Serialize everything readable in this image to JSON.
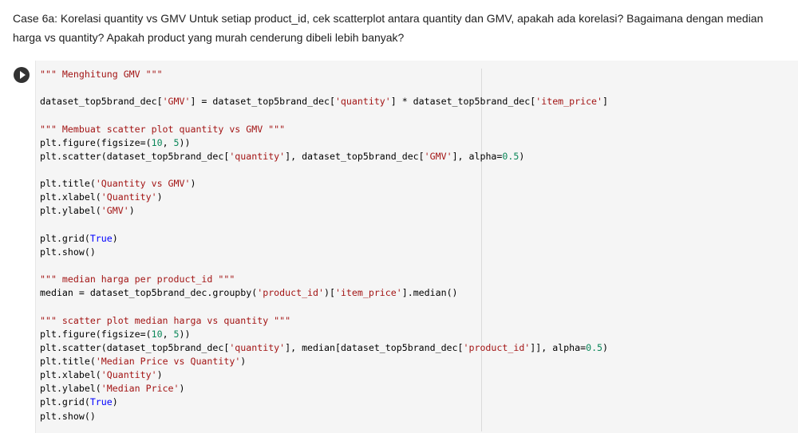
{
  "markdown_cell": {
    "text": "Case 6a: Korelasi quantity vs GMV Untuk setiap product_id, cek scatterplot antara quantity dan GMV, apakah ada korelasi? Bagaimana dengan median harga vs quantity? Apakah product yang murah cenderung dibeli lebih banyak?"
  },
  "code_cell": {
    "run_icon": "play-icon",
    "lines": [
      [
        {
          "t": "\"\"\" Menghitung GMV \"\"\"",
          "c": "str"
        }
      ],
      [],
      [
        {
          "t": "dataset_top5brand_dec[",
          "c": "op"
        },
        {
          "t": "'GMV'",
          "c": "str"
        },
        {
          "t": "] = dataset_top5brand_dec[",
          "c": "op"
        },
        {
          "t": "'quantity'",
          "c": "str"
        },
        {
          "t": "] * dataset_top5brand_dec[",
          "c": "op"
        },
        {
          "t": "'item_price'",
          "c": "str"
        },
        {
          "t": "]",
          "c": "op"
        }
      ],
      [],
      [
        {
          "t": "\"\"\" Membuat scatter plot quantity vs GMV \"\"\"",
          "c": "str"
        }
      ],
      [
        {
          "t": "plt.figure(figsize=(",
          "c": "op"
        },
        {
          "t": "10",
          "c": "num"
        },
        {
          "t": ", ",
          "c": "op"
        },
        {
          "t": "5",
          "c": "num"
        },
        {
          "t": "))",
          "c": "op"
        }
      ],
      [
        {
          "t": "plt.scatter(dataset_top5brand_dec[",
          "c": "op"
        },
        {
          "t": "'quantity'",
          "c": "str"
        },
        {
          "t": "], dataset_top5brand_dec[",
          "c": "op"
        },
        {
          "t": "'GMV'",
          "c": "str"
        },
        {
          "t": "], alpha=",
          "c": "op"
        },
        {
          "t": "0.5",
          "c": "num"
        },
        {
          "t": ")",
          "c": "op"
        }
      ],
      [],
      [
        {
          "t": "plt.title(",
          "c": "op"
        },
        {
          "t": "'Quantity vs GMV'",
          "c": "str"
        },
        {
          "t": ")",
          "c": "op"
        }
      ],
      [
        {
          "t": "plt.xlabel(",
          "c": "op"
        },
        {
          "t": "'Quantity'",
          "c": "str"
        },
        {
          "t": ")",
          "c": "op"
        }
      ],
      [
        {
          "t": "plt.ylabel(",
          "c": "op"
        },
        {
          "t": "'GMV'",
          "c": "str"
        },
        {
          "t": ")",
          "c": "op"
        }
      ],
      [],
      [
        {
          "t": "plt.grid(",
          "c": "op"
        },
        {
          "t": "True",
          "c": "kw"
        },
        {
          "t": ")",
          "c": "op"
        }
      ],
      [
        {
          "t": "plt.show()",
          "c": "op"
        }
      ],
      [],
      [
        {
          "t": "\"\"\" median harga per product_id \"\"\"",
          "c": "str"
        }
      ],
      [
        {
          "t": "median = dataset_top5brand_dec.groupby(",
          "c": "op"
        },
        {
          "t": "'product_id'",
          "c": "str"
        },
        {
          "t": ")[",
          "c": "op"
        },
        {
          "t": "'item_price'",
          "c": "str"
        },
        {
          "t": "].median()",
          "c": "op"
        }
      ],
      [],
      [
        {
          "t": "\"\"\" scatter plot median harga vs quantity \"\"\"",
          "c": "str"
        }
      ],
      [
        {
          "t": "plt.figure(figsize=(",
          "c": "op"
        },
        {
          "t": "10",
          "c": "num"
        },
        {
          "t": ", ",
          "c": "op"
        },
        {
          "t": "5",
          "c": "num"
        },
        {
          "t": "))",
          "c": "op"
        }
      ],
      [
        {
          "t": "plt.scatter(dataset_top5brand_dec[",
          "c": "op"
        },
        {
          "t": "'quantity'",
          "c": "str"
        },
        {
          "t": "], median[dataset_top5brand_dec[",
          "c": "op"
        },
        {
          "t": "'product_id'",
          "c": "str"
        },
        {
          "t": "]], alpha=",
          "c": "op"
        },
        {
          "t": "0.5",
          "c": "num"
        },
        {
          "t": ")",
          "c": "op"
        }
      ],
      [
        {
          "t": "plt.title(",
          "c": "op"
        },
        {
          "t": "'Median Price vs Quantity'",
          "c": "str"
        },
        {
          "t": ")",
          "c": "op"
        }
      ],
      [
        {
          "t": "plt.xlabel(",
          "c": "op"
        },
        {
          "t": "'Quantity'",
          "c": "str"
        },
        {
          "t": ")",
          "c": "op"
        }
      ],
      [
        {
          "t": "plt.ylabel(",
          "c": "op"
        },
        {
          "t": "'Median Price'",
          "c": "str"
        },
        {
          "t": ")",
          "c": "op"
        }
      ],
      [
        {
          "t": "plt.grid(",
          "c": "op"
        },
        {
          "t": "True",
          "c": "kw"
        },
        {
          "t": ")",
          "c": "op"
        }
      ],
      [
        {
          "t": "plt.show()",
          "c": "op"
        }
      ]
    ]
  }
}
